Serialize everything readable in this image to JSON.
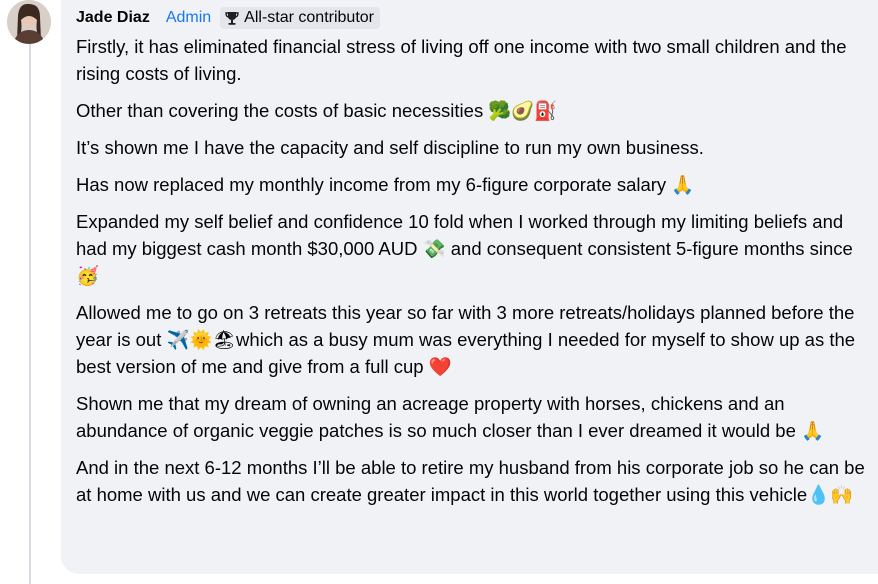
{
  "comment": {
    "author": "Jade Diaz",
    "role": "Admin",
    "badge": {
      "icon": "trophy-icon",
      "label": "All-star contributor"
    },
    "paragraphs": [
      "Firstly, it has eliminated financial stress of living off one income with two small children and the rising costs of living.",
      "Other than covering the costs of basic necessities 🥦🥑⛽",
      "It’s shown me I have the capacity and self discipline to run my own business.",
      "Has now replaced my monthly income from my 6-figure corporate salary 🙏",
      "Expanded my self belief and confidence 10 fold when I worked through my limiting beliefs and had my biggest cash month $30,000 AUD 💸 and consequent consistent 5-figure months since 🥳",
      "Allowed me to go on 3 retreats this year so far with 3 more retreats/holidays planned before the year is out ✈️🌞🏖which as a busy mum was everything I needed for myself to show up as the best version of me and give from a full cup ❤️",
      "Shown me that my dream of owning an acreage property with horses, chickens and an abundance of organic veggie patches is so much closer than I ever dreamed it would be 🙏",
      "And in the next 6-12 months I’ll be able to retire my husband from his corporate job so he can be at home with us and we can create greater impact in this world together using this vehicle💧🙌"
    ]
  },
  "colors": {
    "bubble": "#f0f2f5",
    "role": "#1877f2",
    "badge_bg": "#e4e6eb",
    "text": "#050505"
  }
}
